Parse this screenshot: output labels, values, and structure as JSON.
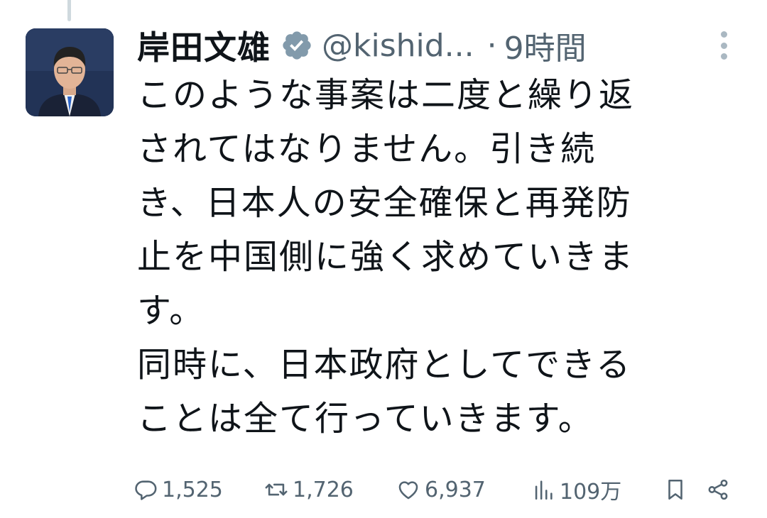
{
  "tweet": {
    "author_name": "岸田文雄",
    "verified_icon": "verified-badge-icon",
    "handle": "@kishid...",
    "separator": "·",
    "time": "9時間",
    "body_lines": [
      "このような事案は二度と繰り返",
      "されてはなりません。引き続",
      "き、日本人の安全確保と再発防",
      "止を中国側に強く求めていきま",
      "す。",
      "同時に、日本政府としてできる",
      "ことは全て行っていきます。"
    ],
    "replies": "1,525",
    "retweets": "1,726",
    "likes": "6,937",
    "views": "109万"
  },
  "colors": {
    "text": "#0f1419",
    "secondary": "#536471",
    "verified_badge": "#829aab"
  }
}
